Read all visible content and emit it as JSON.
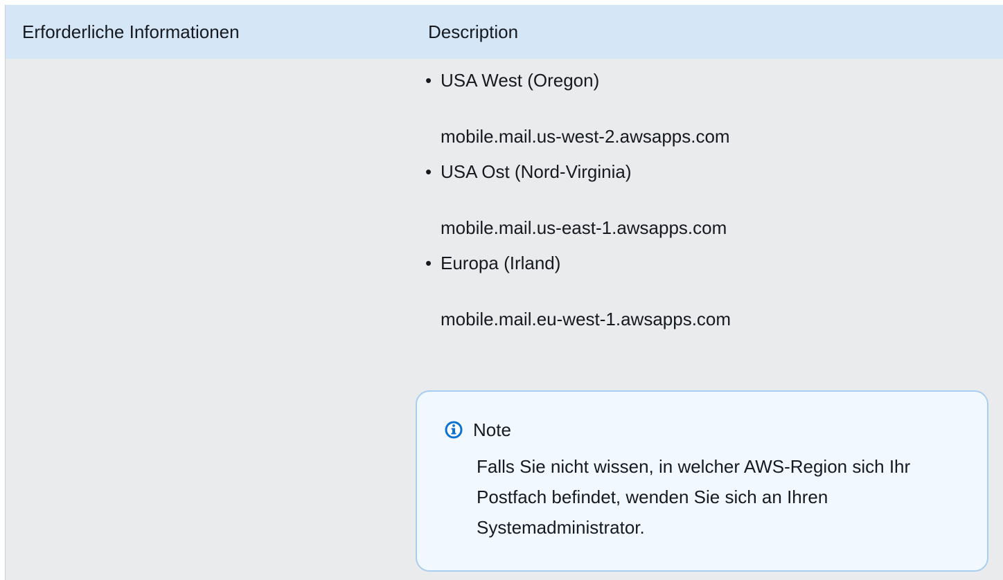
{
  "table": {
    "headers": [
      "Erforderliche Informationen",
      "Description"
    ],
    "regions": [
      {
        "name": "USA West (Oregon)",
        "host": "mobile.mail.us-west-2.awsapps.com"
      },
      {
        "name": "USA Ost (Nord-Virginia)",
        "host": "mobile.mail.us-east-1.awsapps.com"
      },
      {
        "name": "Europa (Irland)",
        "host": "mobile.mail.eu-west-1.awsapps.com"
      }
    ]
  },
  "note": {
    "icon": "info-icon",
    "title": "Note",
    "body": "Falls Sie nicht wissen, in welcher AWS-Region sich Ihr Postfach befindet, wenden Sie sich an Ihren Systemadministrator."
  },
  "colors": {
    "header_bg": "#d5e6f6",
    "row_bg": "#e9ebed",
    "note_bg": "#f1f8ff",
    "note_border": "#a9cdee",
    "info_icon": "#0972d3"
  }
}
